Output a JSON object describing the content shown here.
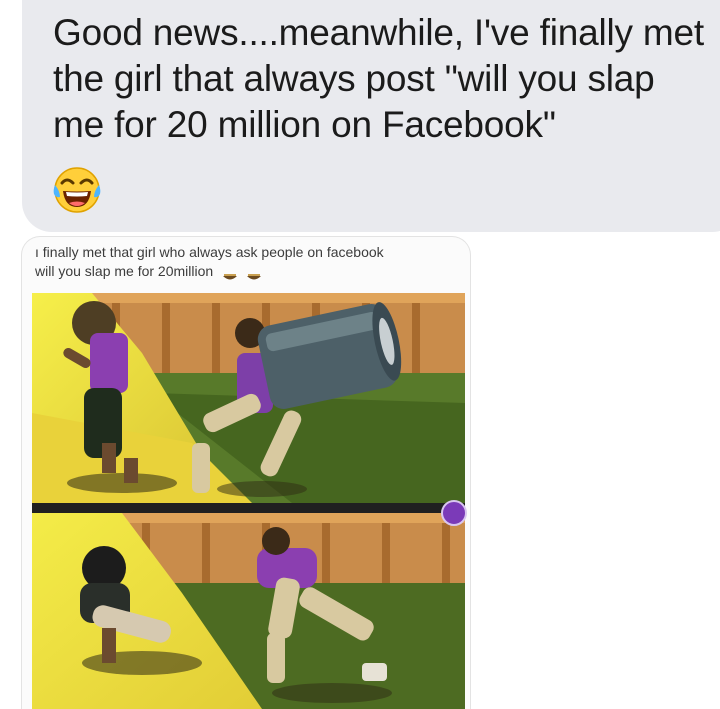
{
  "message": {
    "text": "Good news....meanwhile, I've finally met the girl that always post \"will you slap me for 20 million on Facebook\"",
    "emoji": "tears-of-joy-emoji"
  },
  "shared_image": {
    "caption_line1": "finally met that girl who always ask people on facebook",
    "caption_line2": "will you slap me for 20million",
    "caption_emoji": "laughing-emoji",
    "photos": [
      "top-photo",
      "bottom-photo"
    ]
  },
  "colors": {
    "bubble_background": "#e9eaee",
    "text": "#1b1b1b",
    "accent_green": "#2fd400",
    "badge_purple": "#7b3ab8"
  }
}
